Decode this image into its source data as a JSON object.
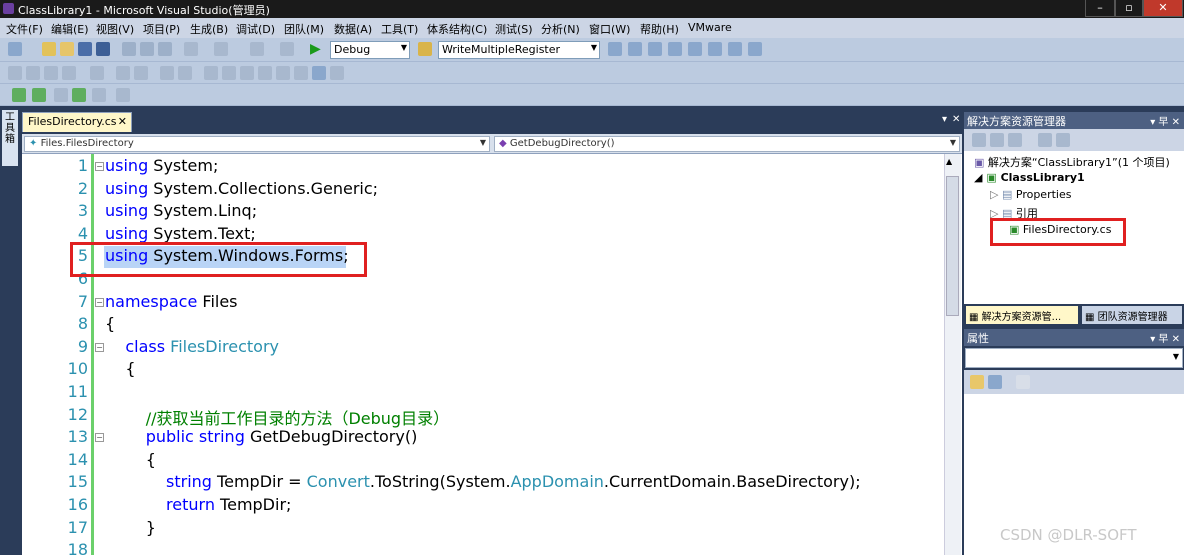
{
  "window": {
    "title": "ClassLibrary1 - Microsoft Visual Studio(管理员)",
    "buttons": [
      "–",
      "▫",
      "✕"
    ]
  },
  "menu": [
    "文件(F)",
    "编辑(E)",
    "视图(V)",
    "项目(P)",
    "生成(B)",
    "调试(D)",
    "团队(M)",
    "数据(A)",
    "工具(T)",
    "体系结构(C)",
    "测试(S)",
    "分析(N)",
    "窗口(W)",
    "帮助(H)",
    "VMware"
  ],
  "toolbar": {
    "config": "Debug",
    "find": "WriteMultipleRegister"
  },
  "toolbox_tab": "工具箱",
  "document": {
    "tab": "FilesDirectory.cs",
    "tab_close": "✕",
    "tab_dropdown": "▾",
    "tab_close_all": "✕",
    "nav_left": "Files.FilesDirectory",
    "nav_right": "GetDebugDirectory()"
  },
  "code": [
    {
      "n": "1",
      "segs": [
        [
          "kw",
          "using"
        ],
        [
          "",
          " System;"
        ]
      ]
    },
    {
      "n": "2",
      "segs": [
        [
          "kw",
          "using"
        ],
        [
          "",
          " System.Collections.Generic;"
        ]
      ]
    },
    {
      "n": "3",
      "segs": [
        [
          "kw",
          "using"
        ],
        [
          "",
          " System.Linq;"
        ]
      ]
    },
    {
      "n": "4",
      "segs": [
        [
          "kw",
          "using"
        ],
        [
          "",
          " System.Text;"
        ]
      ]
    },
    {
      "n": "5",
      "segs": [
        [
          "kw",
          "using"
        ],
        [
          "",
          " System.Windows.Forms;"
        ]
      ]
    },
    {
      "n": "6",
      "segs": []
    },
    {
      "n": "7",
      "segs": [
        [
          "kw",
          "namespace"
        ],
        [
          "",
          " Files"
        ]
      ]
    },
    {
      "n": "8",
      "segs": [
        [
          "",
          "{"
        ]
      ]
    },
    {
      "n": "9",
      "segs": [
        [
          "",
          "    "
        ],
        [
          "kw",
          "class"
        ],
        [
          "",
          " "
        ],
        [
          "ty",
          "FilesDirectory"
        ]
      ]
    },
    {
      "n": "10",
      "segs": [
        [
          "",
          "    {"
        ]
      ]
    },
    {
      "n": "11",
      "segs": []
    },
    {
      "n": "12",
      "segs": [
        [
          "",
          "        "
        ],
        [
          "cm",
          "//获取当前工作目录的方法（Debug目录）"
        ]
      ]
    },
    {
      "n": "13",
      "segs": [
        [
          "",
          "        "
        ],
        [
          "kw",
          "public"
        ],
        [
          "",
          " "
        ],
        [
          "kw",
          "string"
        ],
        [
          "",
          " GetDebugDirectory()"
        ]
      ]
    },
    {
      "n": "14",
      "segs": [
        [
          "",
          "        {"
        ]
      ]
    },
    {
      "n": "15",
      "segs": [
        [
          "",
          "            "
        ],
        [
          "kw",
          "string"
        ],
        [
          "",
          " TempDir = "
        ],
        [
          "ty",
          "Convert"
        ],
        [
          "",
          ".ToString(System."
        ],
        [
          "ty",
          "AppDomain"
        ],
        [
          "",
          ".CurrentDomain.BaseDirectory);"
        ]
      ]
    },
    {
      "n": "16",
      "segs": [
        [
          "",
          "            "
        ],
        [
          "kw",
          "return"
        ],
        [
          "",
          " TempDir;"
        ]
      ]
    },
    {
      "n": "17",
      "segs": [
        [
          "",
          "        }"
        ]
      ]
    },
    {
      "n": "18",
      "segs": []
    }
  ],
  "solution_explorer": {
    "title": "解决方案资源管理器",
    "pin": "▾ 早 ✕",
    "items": [
      {
        "label": "解决方案“ClassLibrary1”(1 个项目)"
      },
      {
        "label": "ClassLibrary1"
      },
      {
        "label": "Properties"
      },
      {
        "label": "引用"
      },
      {
        "label": "FilesDirectory.cs"
      }
    ],
    "tabs": [
      "解决方案资源管...",
      "团队资源管理器"
    ]
  },
  "properties": {
    "title": "属性",
    "pin": "▾ 早 ✕"
  },
  "watermark": "CSDN @DLR-SOFT",
  "colors": {
    "keyword": "#0000ff",
    "type": "#2b91af",
    "comment": "#008000",
    "highlight": "#e02020"
  }
}
